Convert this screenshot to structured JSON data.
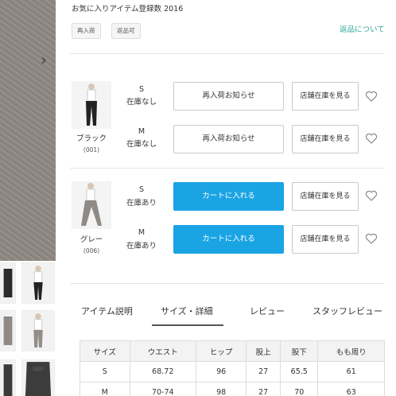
{
  "gallery": {
    "next_arrow": "›",
    "thumbnails": [
      "trousers-front",
      "model-walking",
      "trousers-back",
      "trousers-grey",
      "model-grey",
      "model-grey-front",
      "trousers-detail"
    ]
  },
  "header": {
    "favorite_count_label": "お気に入りアイテム登録数",
    "favorite_count": "2016",
    "tags": [
      "再入荷",
      "返品可"
    ],
    "return_policy_link": "返品について"
  },
  "variants": [
    {
      "color_name": "ブラック",
      "color_code": "(001)",
      "sizes": [
        {
          "size": "S",
          "stock": "在庫なし",
          "action_label": "再入荷お知らせ",
          "action_type": "restock",
          "store_label": "店舗在庫を見る"
        },
        {
          "size": "M",
          "stock": "在庫なし",
          "action_label": "再入荷お知らせ",
          "action_type": "restock",
          "store_label": "店舗在庫を見る"
        }
      ]
    },
    {
      "color_name": "グレー",
      "color_code": "(006)",
      "sizes": [
        {
          "size": "S",
          "stock": "在庫あり",
          "action_label": "カートに入れる",
          "action_type": "cart",
          "store_label": "店舗在庫を見る"
        },
        {
          "size": "M",
          "stock": "在庫あり",
          "action_label": "カートに入れる",
          "action_type": "cart",
          "store_label": "店舗在庫を見る"
        }
      ]
    }
  ],
  "tabs": [
    {
      "label": "アイテム説明",
      "active": false
    },
    {
      "label": "サイズ・詳細",
      "active": true
    },
    {
      "label": "レビュー",
      "active": false
    },
    {
      "label": "スタッフレビュー",
      "active": false
    }
  ],
  "size_table": {
    "headers": [
      "サイズ",
      "ウエスト",
      "ヒップ",
      "股上",
      "股下",
      "もも周り"
    ],
    "rows": [
      [
        "S",
        "68.72",
        "96",
        "27",
        "65.5",
        "61"
      ],
      [
        "M",
        "70-74",
        "98",
        "27",
        "70",
        "63"
      ]
    ]
  },
  "colors": {
    "accent_cart": "#1aa4e4",
    "link": "#2aa79a"
  }
}
